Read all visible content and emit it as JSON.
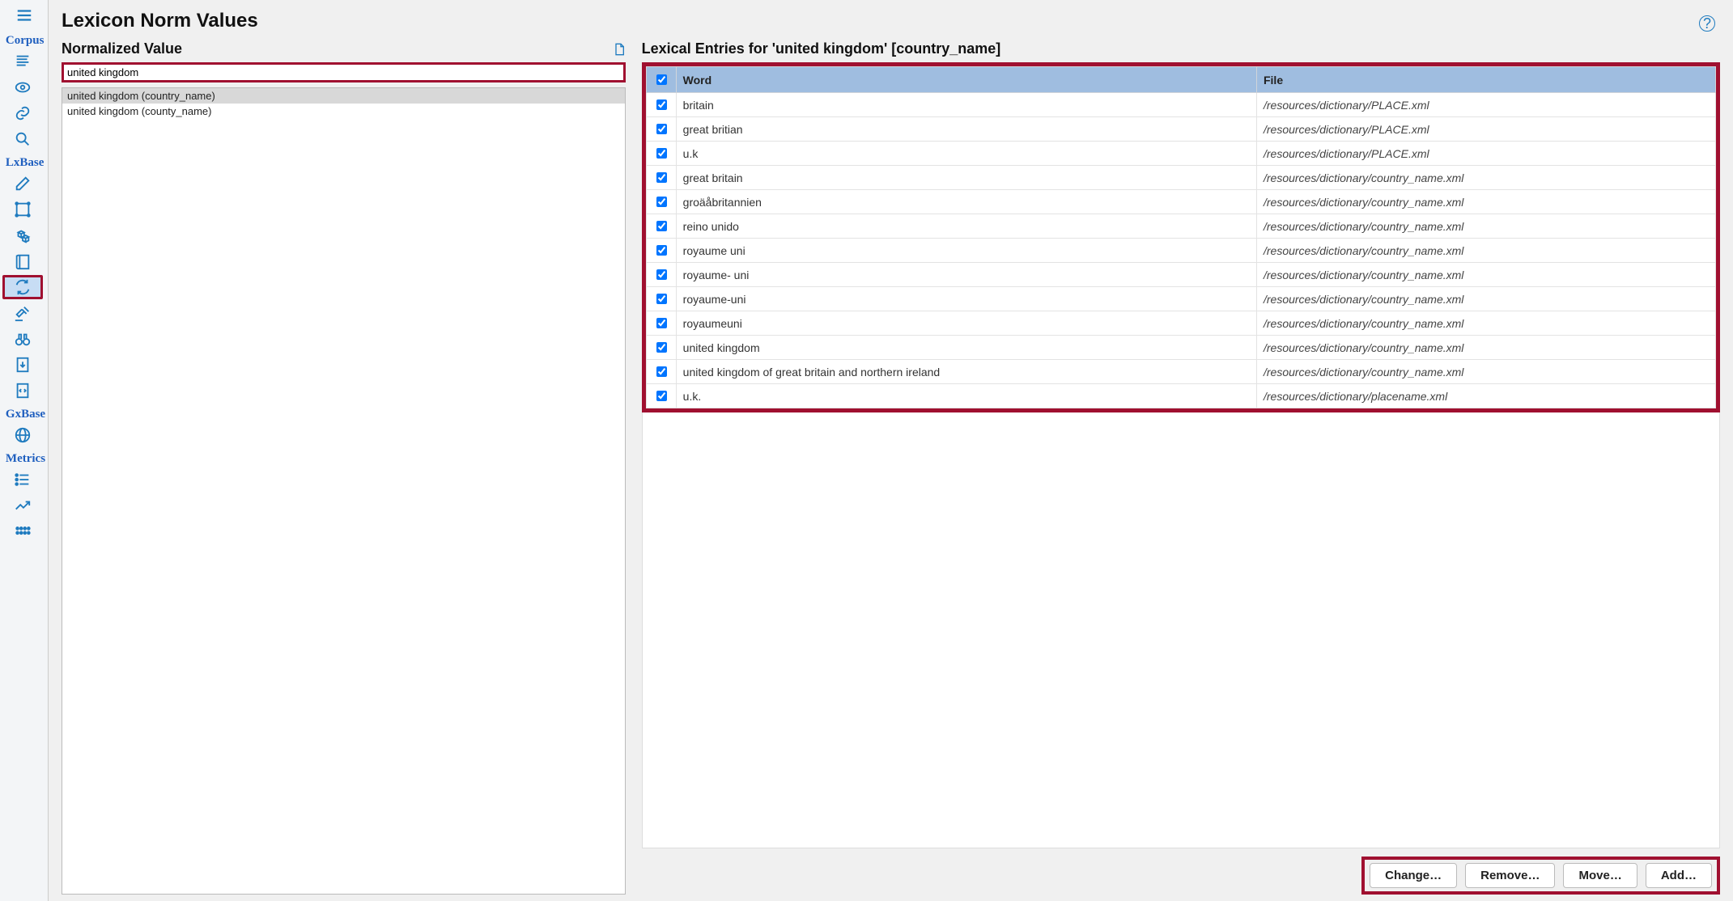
{
  "page": {
    "title": "Lexicon Norm Values"
  },
  "sidebar": {
    "sections": [
      {
        "label": "Corpus",
        "items": [
          {
            "name": "sidebar-corpus-doc",
            "icon": "lines"
          },
          {
            "name": "sidebar-corpus-eye",
            "icon": "eye"
          },
          {
            "name": "sidebar-corpus-link",
            "icon": "link"
          },
          {
            "name": "sidebar-corpus-search",
            "icon": "search"
          }
        ]
      },
      {
        "label": "LxBase",
        "items": [
          {
            "name": "sidebar-lx-edit",
            "icon": "edit"
          },
          {
            "name": "sidebar-lx-select",
            "icon": "select"
          },
          {
            "name": "sidebar-lx-cubes",
            "icon": "cubes"
          },
          {
            "name": "sidebar-lx-book",
            "icon": "book"
          },
          {
            "name": "sidebar-lx-norm",
            "icon": "cycle",
            "active": true
          },
          {
            "name": "sidebar-lx-gavel",
            "icon": "gavel"
          },
          {
            "name": "sidebar-lx-binoculars",
            "icon": "binoculars"
          },
          {
            "name": "sidebar-lx-download",
            "icon": "download"
          },
          {
            "name": "sidebar-lx-code",
            "icon": "code"
          }
        ]
      },
      {
        "label": "GxBase",
        "items": [
          {
            "name": "sidebar-gx-globe",
            "icon": "globe"
          }
        ]
      },
      {
        "label": "Metrics",
        "items": [
          {
            "name": "sidebar-metrics-list",
            "icon": "list"
          },
          {
            "name": "sidebar-metrics-chart",
            "icon": "chart"
          },
          {
            "name": "sidebar-metrics-dots",
            "icon": "dots"
          }
        ]
      }
    ]
  },
  "normalized": {
    "label": "Normalized Value",
    "input_value": "united kingdom",
    "list": [
      {
        "text": "united kingdom (country_name)",
        "selected": true
      },
      {
        "text": "united kingdom (county_name)",
        "selected": false
      }
    ]
  },
  "entries": {
    "label": "Lexical Entries for 'united kingdom' [country_name]",
    "columns": {
      "word": "Word",
      "file": "File"
    },
    "rows": [
      {
        "word": "britain",
        "file": "/resources/dictionary/PLACE.xml",
        "checked": true
      },
      {
        "word": "great britian",
        "file": "/resources/dictionary/PLACE.xml",
        "checked": true
      },
      {
        "word": "u.k",
        "file": "/resources/dictionary/PLACE.xml",
        "checked": true
      },
      {
        "word": "great britain",
        "file": "/resources/dictionary/country_name.xml",
        "checked": true
      },
      {
        "word": "groäåbritannien",
        "file": "/resources/dictionary/country_name.xml",
        "checked": true
      },
      {
        "word": "reino unido",
        "file": "/resources/dictionary/country_name.xml",
        "checked": true
      },
      {
        "word": "royaume uni",
        "file": "/resources/dictionary/country_name.xml",
        "checked": true
      },
      {
        "word": "royaume- uni",
        "file": "/resources/dictionary/country_name.xml",
        "checked": true
      },
      {
        "word": "royaume-uni",
        "file": "/resources/dictionary/country_name.xml",
        "checked": true
      },
      {
        "word": "royaumeuni",
        "file": "/resources/dictionary/country_name.xml",
        "checked": true
      },
      {
        "word": "united kingdom",
        "file": "/resources/dictionary/country_name.xml",
        "checked": true
      },
      {
        "word": "united kingdom of great britain and northern ireland",
        "file": "/resources/dictionary/country_name.xml",
        "checked": true
      },
      {
        "word": "u.k.",
        "file": "/resources/dictionary/placename.xml",
        "checked": true
      }
    ]
  },
  "actions": {
    "change": "Change…",
    "remove": "Remove…",
    "move": "Move…",
    "add": "Add…"
  }
}
